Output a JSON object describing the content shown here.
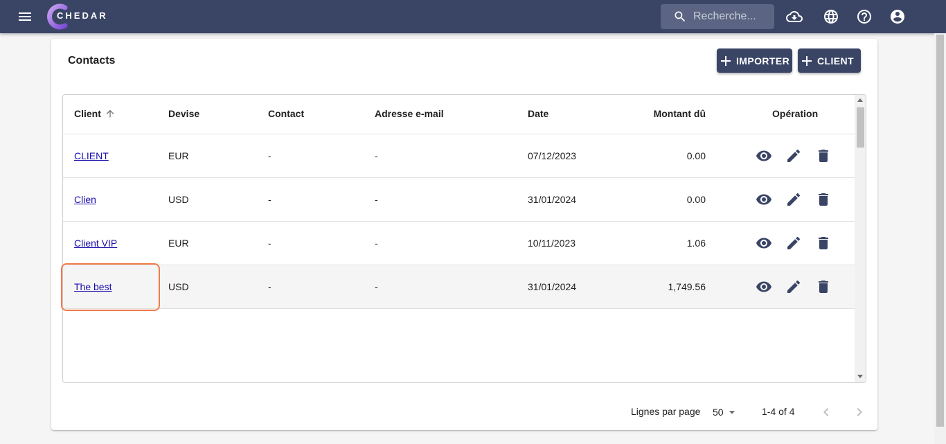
{
  "app": {
    "brand": "CHEDAR",
    "search_placeholder": "Recherche..."
  },
  "header": {
    "icons": [
      "menu-icon",
      "cloud-download-icon",
      "globe-icon",
      "help-icon",
      "account-icon"
    ]
  },
  "page": {
    "title": "Contacts",
    "import_label": "IMPORTER",
    "add_client_label": "CLIENT"
  },
  "table": {
    "columns": {
      "client": "Client",
      "devise": "Devise",
      "contact": "Contact",
      "email": "Adresse e-mail",
      "date": "Date",
      "montant": "Montant dû",
      "operation": "Opération"
    },
    "rows": [
      {
        "client": "CLIENT",
        "devise": "EUR",
        "contact": "-",
        "email": "-",
        "date": "07/12/2023",
        "montant": "0.00"
      },
      {
        "client": "Clien",
        "devise": "USD",
        "contact": "-",
        "email": "-",
        "date": "31/01/2024",
        "montant": "0.00"
      },
      {
        "client": "Client VIP",
        "devise": "EUR",
        "contact": "-",
        "email": "-",
        "date": "10/11/2023",
        "montant": "1.06"
      },
      {
        "client": "The best",
        "devise": "USD",
        "contact": "-",
        "email": "-",
        "date": "31/01/2024",
        "montant": "1,749.56"
      }
    ]
  },
  "pagination": {
    "rows_per_page_label": "Lignes par page",
    "rows_per_page": "50",
    "range": "1-4 of 4"
  },
  "colors": {
    "primary": "#3a4566",
    "highlight": "#f07b4a",
    "link": "#1a0dab"
  }
}
